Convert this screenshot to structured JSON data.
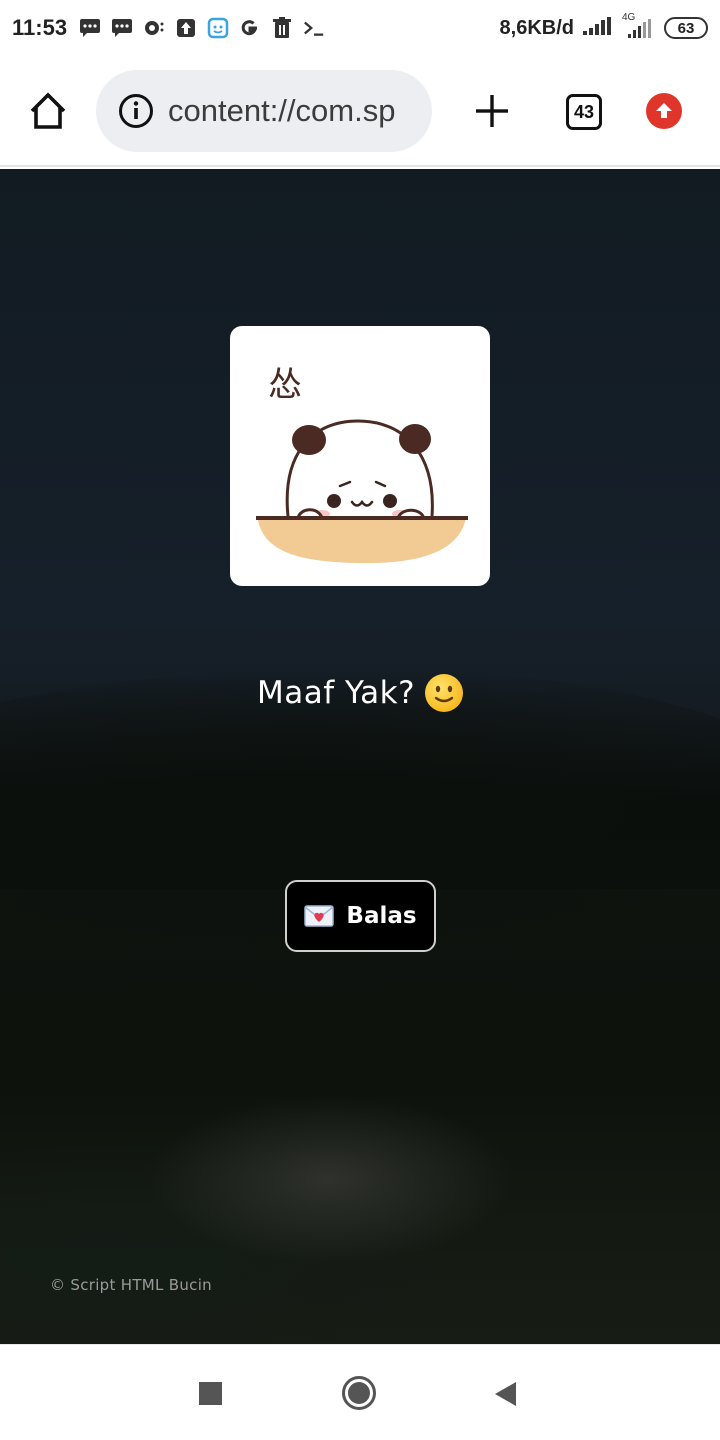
{
  "status_bar": {
    "time": "11:53",
    "net_speed": "8,6KB/d",
    "network_type": "4G",
    "battery": "63",
    "notification_icons": [
      "message-icon",
      "message-icon",
      "chat-bubble-icon",
      "upload-icon",
      "app-icon",
      "google-icon",
      "trash-icon",
      "terminal-icon"
    ]
  },
  "browser": {
    "url": "content://com.sp",
    "tab_count": "43",
    "icons": {
      "home": "home-icon",
      "info": "info-icon",
      "new_tab": "plus-icon",
      "update": "update-arrow-icon"
    }
  },
  "page": {
    "sticker_text": "怂",
    "message": "Maaf Yak?",
    "message_emoji": "slightly-smiling-face",
    "reply_button": "Balas",
    "reply_icon": "love-letter-icon",
    "footer": "© Script HTML Bucin"
  },
  "colors": {
    "update_red": "#e0352b",
    "sticker_bowl": "#f2cb94",
    "sticker_outline": "#4a2a22"
  },
  "nav_bar": {
    "buttons": [
      "recents",
      "home",
      "back"
    ]
  }
}
